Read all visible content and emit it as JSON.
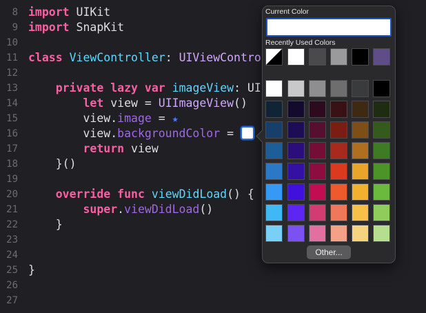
{
  "editor": {
    "lines": [
      {
        "num": "8",
        "tokens": [
          {
            "t": "import",
            "c": "kw"
          },
          {
            "t": " UIKit",
            "c": "plain"
          }
        ]
      },
      {
        "num": "9",
        "tokens": [
          {
            "t": "import",
            "c": "kw"
          },
          {
            "t": " SnapKit",
            "c": "plain"
          }
        ]
      },
      {
        "num": "10",
        "tokens": []
      },
      {
        "num": "11",
        "tokens": [
          {
            "t": "class",
            "c": "kw"
          },
          {
            "t": " ",
            "c": "plain"
          },
          {
            "t": "ViewController",
            "c": "type"
          },
          {
            "t": ": ",
            "c": "plain"
          },
          {
            "t": "UIViewControlle",
            "c": "type2"
          }
        ]
      },
      {
        "num": "12",
        "tokens": []
      },
      {
        "num": "13",
        "tokens": [
          {
            "t": "    private",
            "c": "kw"
          },
          {
            "t": " ",
            "c": "plain"
          },
          {
            "t": "lazy",
            "c": "kw"
          },
          {
            "t": " ",
            "c": "plain"
          },
          {
            "t": "var",
            "c": "kw"
          },
          {
            "t": " ",
            "c": "plain"
          },
          {
            "t": "imageView",
            "c": "type"
          },
          {
            "t": ": UI",
            "c": "plain"
          }
        ]
      },
      {
        "num": "14",
        "tokens": [
          {
            "t": "        let",
            "c": "kw"
          },
          {
            "t": " view = ",
            "c": "plain"
          },
          {
            "t": "UIImageView",
            "c": "type2"
          },
          {
            "t": "()",
            "c": "plain"
          }
        ]
      },
      {
        "num": "15",
        "tokens": [
          {
            "t": "        view.",
            "c": "plain"
          },
          {
            "t": "image",
            "c": "prop"
          },
          {
            "t": " = ",
            "c": "plain"
          },
          {
            "t": "★",
            "c": "star"
          }
        ]
      },
      {
        "num": "16",
        "tokens": [
          {
            "t": "        view.",
            "c": "plain"
          },
          {
            "t": "backgroundColor",
            "c": "prop"
          },
          {
            "t": " = ",
            "c": "plain"
          },
          {
            "t": "",
            "c": "well"
          }
        ]
      },
      {
        "num": "17",
        "tokens": [
          {
            "t": "        return",
            "c": "kw"
          },
          {
            "t": " view",
            "c": "plain"
          }
        ]
      },
      {
        "num": "18",
        "tokens": [
          {
            "t": "    }()",
            "c": "plain"
          }
        ]
      },
      {
        "num": "19",
        "tokens": []
      },
      {
        "num": "20",
        "tokens": [
          {
            "t": "    override",
            "c": "kw"
          },
          {
            "t": " ",
            "c": "plain"
          },
          {
            "t": "func",
            "c": "kw"
          },
          {
            "t": " ",
            "c": "plain"
          },
          {
            "t": "viewDidLoad",
            "c": "type"
          },
          {
            "t": "() {",
            "c": "plain"
          }
        ]
      },
      {
        "num": "21",
        "tokens": [
          {
            "t": "        super",
            "c": "kw"
          },
          {
            "t": ".",
            "c": "plain"
          },
          {
            "t": "viewDidLoad",
            "c": "prop"
          },
          {
            "t": "()",
            "c": "plain"
          }
        ]
      },
      {
        "num": "22",
        "tokens": [
          {
            "t": "    }",
            "c": "plain"
          }
        ]
      },
      {
        "num": "23",
        "tokens": []
      },
      {
        "num": "24",
        "tokens": []
      },
      {
        "num": "25",
        "tokens": [
          {
            "t": "}",
            "c": "plain"
          }
        ]
      },
      {
        "num": "26",
        "tokens": []
      },
      {
        "num": "27",
        "tokens": []
      }
    ]
  },
  "color_picker": {
    "current_label": "Current Color",
    "current_color": "#ffffff",
    "recent_label": "Recently Used Colors",
    "recent_colors": [
      "diagonal-white-black",
      "#ffffff",
      "#4a4a4c",
      "#9a9a9c",
      "#000000",
      "#5e4d86"
    ],
    "palette": [
      [
        "#ffffff",
        "#c8c8c8",
        "#8e8e8e",
        "#6e6e6e",
        "#3a3b3d",
        "#000000"
      ],
      [
        "#0f2535",
        "#130a2d",
        "#2e0a1f",
        "#3a1114",
        "#3e2a10",
        "#1e2d12"
      ],
      [
        "#183e6a",
        "#1e0c55",
        "#550f30",
        "#7a1d12",
        "#7d4f16",
        "#345a1e"
      ],
      [
        "#1d5e98",
        "#2b0d7c",
        "#760d36",
        "#a82a1c",
        "#ae6f1e",
        "#3f7a24"
      ],
      [
        "#2a78c6",
        "#3511a3",
        "#8e0c40",
        "#dc3a1e",
        "#e9a52a",
        "#4d9428"
      ],
      [
        "#3599f5",
        "#4010dd",
        "#c20d52",
        "#ee5a2e",
        "#f1b12f",
        "#6bba3e"
      ],
      [
        "#3fb8f5",
        "#5e26f2",
        "#d33c70",
        "#f0785a",
        "#f6c048",
        "#8fcc5c"
      ],
      [
        "#78d0f7",
        "#7b51f1",
        "#e170a0",
        "#f3a285",
        "#f6d37f",
        "#b5df8e"
      ]
    ],
    "other_button": "Other..."
  }
}
